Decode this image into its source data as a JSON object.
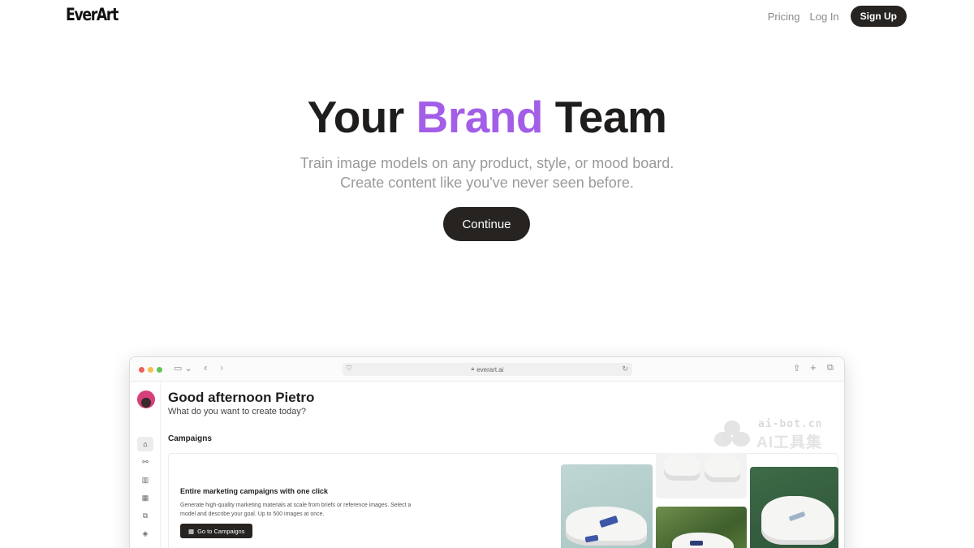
{
  "nav": {
    "logo": "EverArt",
    "links": [
      "Pricing",
      "Log In"
    ],
    "signup_label": "Sign Up"
  },
  "hero": {
    "title_before": "Your ",
    "title_accent": "Brand",
    "title_after": " Team",
    "subtitle_line1": "Train image models on any product, style, or mood board.",
    "subtitle_line2": "Create content like you've never seen before.",
    "cta_label": "Continue"
  },
  "colors": {
    "accent": "#a35ee8",
    "dark_button": "#262321",
    "muted_text": "#9a9a9a"
  },
  "browser": {
    "url": "everart.ai",
    "greeting": "Good afternoon Pietro",
    "greeting_sub": "What do you want to create today?",
    "section_title": "Campaigns",
    "card": {
      "title": "Entire marketing campaigns with one click",
      "description": "Generate high-quality marketing materials at scale from briefs or reference images. Select a model and describe your goal. Up to 500 images at once.",
      "button_label": "Go to Campaigns"
    },
    "sidebar_icons": [
      "home-icon",
      "models-icon",
      "library-icon",
      "campaigns-icon",
      "gallery-icon",
      "layers-icon"
    ]
  },
  "watermark": {
    "line1": "ai-bot.cn",
    "line2": "AI工具集"
  }
}
